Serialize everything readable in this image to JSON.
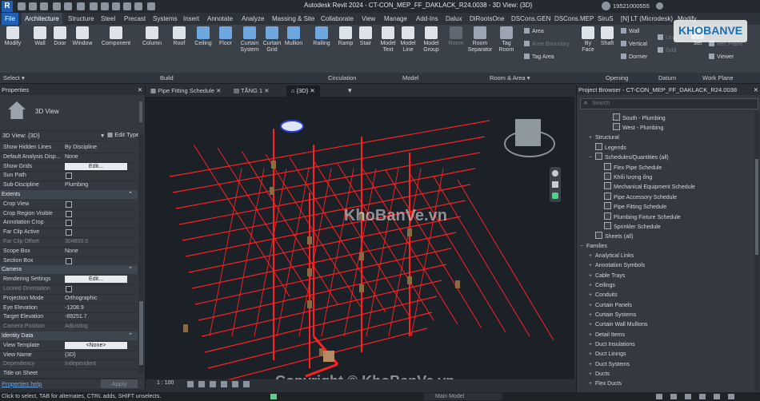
{
  "window": {
    "title": "Autodesk Revit 2024 - CT-CON_MEP_FF_DAKLACK_R24.0038 - 3D View: {3D}",
    "user": "19521000555",
    "logo_letter": "R"
  },
  "ribbon_tabs": [
    "File",
    "Architecture",
    "Structure",
    "Steel",
    "Precast",
    "Systems",
    "Insert",
    "Annotate",
    "Analyze",
    "Massing & Site",
    "Collaborate",
    "View",
    "Manage",
    "Add-Ins",
    "Dalux",
    "DiRootsOne",
    "DSCons.GEN",
    "DSCons.MEP",
    "SiruS",
    "[N] LT (Microdesk)",
    "Modify"
  ],
  "ribbon": {
    "buttons": [
      {
        "label": "Modify",
        "icon": "cursor-icon"
      },
      {
        "label": "Wall",
        "icon": "wall-icon"
      },
      {
        "label": "Door",
        "icon": "door-icon"
      },
      {
        "label": "Window",
        "icon": "window-icon"
      },
      {
        "label": "Component",
        "icon": "component-icon"
      },
      {
        "label": "Column",
        "icon": "column-icon"
      },
      {
        "label": "Roof",
        "icon": "roof-icon"
      },
      {
        "label": "Ceiling",
        "icon": "ceiling-icon"
      },
      {
        "label": "Floor",
        "icon": "floor-icon"
      },
      {
        "label": "Curtain System",
        "icon": "curtain-system-icon"
      },
      {
        "label": "Curtain Grid",
        "icon": "curtain-grid-icon"
      },
      {
        "label": "Mullion",
        "icon": "mullion-icon"
      },
      {
        "label": "Railing",
        "icon": "railing-icon"
      },
      {
        "label": "Ramp",
        "icon": "ramp-icon"
      },
      {
        "label": "Stair",
        "icon": "stair-icon"
      },
      {
        "label": "Model Text",
        "icon": "model-text-icon"
      },
      {
        "label": "Model Line",
        "icon": "model-line-icon"
      },
      {
        "label": "Model Group",
        "icon": "model-group-icon"
      },
      {
        "label": "Room",
        "icon": "room-icon"
      },
      {
        "label": "Room Separator",
        "icon": "room-separator-icon"
      },
      {
        "label": "Tag Room",
        "icon": "tag-room-icon"
      },
      {
        "label": "By Face",
        "icon": "by-face-icon"
      },
      {
        "label": "Shaft",
        "icon": "shaft-icon"
      },
      {
        "label": "Level",
        "icon": "level-icon"
      },
      {
        "label": "Grid",
        "icon": "grid-icon"
      },
      {
        "label": "Set",
        "icon": "set-icon"
      }
    ],
    "small": {
      "area": "Area",
      "area_boundary": "Area Boundary",
      "tag_area": "Tag Area",
      "wall": "Wall",
      "vertical": "Vertical",
      "dormer": "Dormer",
      "ref_plane": "Ref. Plane",
      "viewer": "Viewer",
      "show": "Show"
    },
    "panels": [
      "Select",
      "Build",
      "Circulation",
      "Model",
      "Room & Area",
      "Opening",
      "Datum",
      "Work Plane"
    ]
  },
  "properties": {
    "title": "Properties",
    "type_name": "3D View",
    "selector": "3D View: {3D}",
    "edit_type": "Edit Type",
    "rows_top": [
      {
        "k": "Show Hidden Lines",
        "v": "By Discipline"
      },
      {
        "k": "Default Analysis Disp...",
        "v": "None"
      },
      {
        "k": "Show Grids",
        "btn": "Edit..."
      },
      {
        "k": "Sun Path",
        "cb": true
      },
      {
        "k": "Sub-Discipline",
        "v": "Plumbing"
      }
    ],
    "extents_title": "Extents",
    "extents": [
      {
        "k": "Crop View",
        "cb": true
      },
      {
        "k": "Crop Region Visible",
        "cb": true
      },
      {
        "k": "Annotation Crop",
        "cb": true
      },
      {
        "k": "Far Clip Active",
        "cb": true
      },
      {
        "k": "Far Clip Offset",
        "v": "304800.0",
        "dis": true
      },
      {
        "k": "Scope Box",
        "v": "None"
      },
      {
        "k": "Section Box",
        "cb": true
      }
    ],
    "camera_title": "Camera",
    "camera": [
      {
        "k": "Rendering Settings",
        "btn": "Edit..."
      },
      {
        "k": "Locked Orientation",
        "cb": true,
        "dis": true
      },
      {
        "k": "Projection Mode",
        "v": "Orthographic"
      },
      {
        "k": "Eye Elevation",
        "v": "-1208.9"
      },
      {
        "k": "Target Elevation",
        "v": "-89251.7"
      },
      {
        "k": "Camera Position",
        "v": "Adjusting",
        "dis": true
      }
    ],
    "identity_title": "Identity Data",
    "identity": [
      {
        "k": "View Template",
        "btn": "<None>"
      },
      {
        "k": "View Name",
        "v": "{3D}"
      },
      {
        "k": "Dependency",
        "v": "Independent",
        "dis": true
      },
      {
        "k": "Title on Sheet",
        "v": ""
      }
    ],
    "help": "Properties help",
    "apply": "Apply"
  },
  "view_tabs": [
    "Pipe Fitting Schedule",
    "TẦNG 1",
    "{3D}"
  ],
  "view_scale": "1 : 100",
  "project_browser": {
    "title": "Project Browser - CT-CON_MEP_FF_DAKLACK_R24.0038",
    "search_placeholder": "Search",
    "items": [
      {
        "t": "South - Plumbing",
        "lvl": 3,
        "sq": true
      },
      {
        "t": "West - Plumbing",
        "lvl": 3,
        "sq": true
      },
      {
        "t": "Structural",
        "lvl": 1,
        "ex": "+"
      },
      {
        "t": "Legends",
        "lvl": 1,
        "sq": true
      },
      {
        "t": "Schedules/Quantities (all)",
        "lvl": 1,
        "ex": "−",
        "sq": true
      },
      {
        "t": "Flex Pipe Schedule",
        "lvl": 2,
        "sq": true
      },
      {
        "t": "Khối lượng ống",
        "lvl": 2,
        "sq": true
      },
      {
        "t": "Mechanical Equipment Schedule",
        "lvl": 2,
        "sq": true
      },
      {
        "t": "Pipe Accessory Schedule",
        "lvl": 2,
        "sq": true
      },
      {
        "t": "Pipe Fitting Schedule",
        "lvl": 2,
        "sq": true
      },
      {
        "t": "Plumbing Fixture Schedule",
        "lvl": 2,
        "sq": true
      },
      {
        "t": "Sprinkler Schedule",
        "lvl": 2,
        "sq": true
      },
      {
        "t": "Sheets (all)",
        "lvl": 1,
        "sq": true
      },
      {
        "t": "Families",
        "lvl": 0,
        "ex": "−"
      },
      {
        "t": "Analytical Links",
        "lvl": 1,
        "ex": "+"
      },
      {
        "t": "Annotation Symbols",
        "lvl": 1,
        "ex": "+"
      },
      {
        "t": "Cable Trays",
        "lvl": 1,
        "ex": "+"
      },
      {
        "t": "Ceilings",
        "lvl": 1,
        "ex": "+"
      },
      {
        "t": "Conduits",
        "lvl": 1,
        "ex": "+"
      },
      {
        "t": "Curtain Panels",
        "lvl": 1,
        "ex": "+"
      },
      {
        "t": "Curtain Systems",
        "lvl": 1,
        "ex": "+"
      },
      {
        "t": "Curtain Wall Mullions",
        "lvl": 1,
        "ex": "+"
      },
      {
        "t": "Detail Items",
        "lvl": 1,
        "ex": "+"
      },
      {
        "t": "Duct Insulations",
        "lvl": 1,
        "ex": "+"
      },
      {
        "t": "Duct Linings",
        "lvl": 1,
        "ex": "+"
      },
      {
        "t": "Duct Systems",
        "lvl": 1,
        "ex": "+"
      },
      {
        "t": "Ducts",
        "lvl": 1,
        "ex": "+"
      },
      {
        "t": "Flex Ducts",
        "lvl": 1,
        "ex": "+"
      }
    ]
  },
  "status": {
    "hint": "Click to select, TAB for alternates, CTRL adds, SHIFT unselects.",
    "model": "Main Model"
  },
  "watermarks": {
    "logo": "KHOBANVE",
    "center": "KhoBanVe.vn",
    "bottom": "Copyright © KhoBanVe.vn"
  },
  "colors": {
    "pipes": "#ff2020",
    "accent": "#1f5fb4"
  }
}
